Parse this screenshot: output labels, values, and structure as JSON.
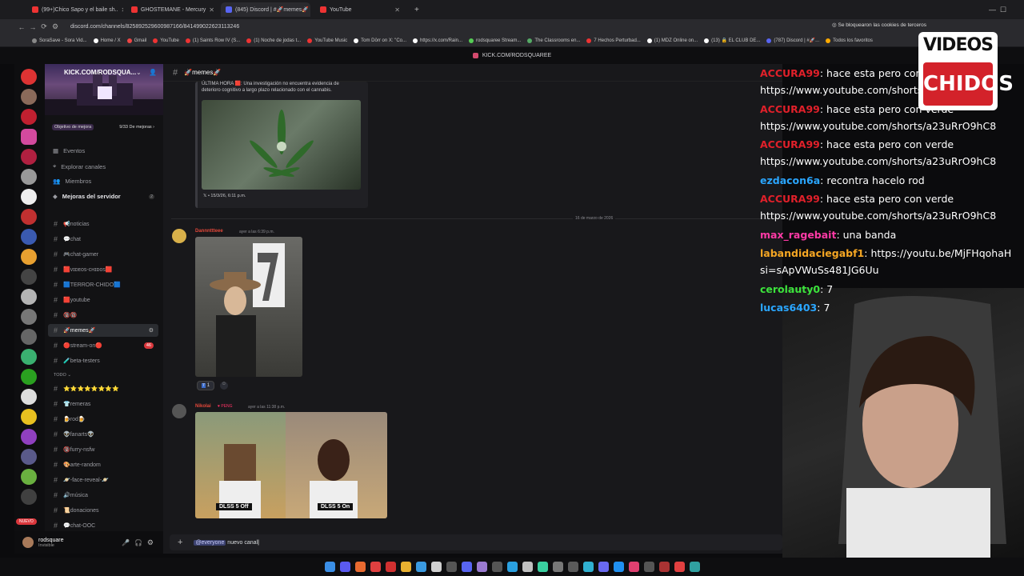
{
  "browser": {
    "tabs": [
      {
        "label": "(99+)Chico Sapo y el baile sh..",
        "color": "#e33"
      },
      {
        "label": "GHOSTEMANE - Mercury",
        "color": "#e33"
      },
      {
        "label": "(845) Discord | #🚀memes🚀",
        "color": "#5865f2"
      },
      {
        "label": "YouTube",
        "color": "#e33"
      }
    ],
    "url": "discord.com/channels/825892529600987166/841499022623113246",
    "cookie_notice": "Se bloquearon las cookies de terceros",
    "bookmarks": [
      "SoraSave - Sora Vid...",
      "Home / X",
      "Gmail",
      "YouTube",
      "(1) Saints Row IV (S...",
      "(1) Noche de jodas t...",
      "YouTube Music",
      "Tom Dōrr on X: \"Co...",
      "https://x.com/Rain...",
      "rodsquaree Stream...",
      "The Classrooms en...",
      "7 Hechos Perturbad...",
      "(1) MDZ Online on...",
      "(13) 🔒 EL CLUB DE...",
      "(787) Discord | #🚀...",
      "Todos los favoritos"
    ]
  },
  "discord": {
    "title_strip": "KICK.COM/RODSQUAREE",
    "server_name": "KICK.COM/RODSQUA...",
    "boost": {
      "left": "Objetivo de mejora",
      "right": "9/33 De mejoras ›"
    },
    "sections": [
      {
        "label": "Eventos"
      },
      {
        "label": "Explorar canales"
      },
      {
        "label": "Miembros"
      },
      {
        "label": "Mejoras del servidor",
        "badge": "2"
      }
    ],
    "channels": [
      {
        "label": "📢noticias"
      },
      {
        "label": "💬chat"
      },
      {
        "label": "🎮chat-gamer"
      },
      {
        "label": "🟥ᴠɪᴅᴇᴏs-ᴄʜɪᴅᴏs🟥"
      },
      {
        "label": "🟦TERROR-CHIDO🟦"
      },
      {
        "label": "🟥youtube"
      },
      {
        "label": "🔞🔞"
      },
      {
        "label": "🚀memes🚀",
        "selected": true
      },
      {
        "label": "🔴stream-on🔴",
        "badge": "46"
      },
      {
        "label": "🧪beta-testers"
      },
      {
        "label": "TODO ⌄",
        "category": true
      },
      {
        "label": "⭐⭐⭐⭐⭐⭐⭐⭐"
      },
      {
        "label": "👕remeras"
      },
      {
        "label": "🍺rod🍺"
      },
      {
        "label": "👽fanarts👽"
      },
      {
        "label": "🔞furry-nsfw"
      },
      {
        "label": "🎨arte-random"
      },
      {
        "label": "🪐-face-reveal-🪐"
      },
      {
        "label": "🔊música"
      },
      {
        "label": "📜donaciones"
      },
      {
        "label": "💬chat-OOC"
      }
    ],
    "new_badge": "NUEVO",
    "user": {
      "name": "rodsquare",
      "status": "Invisible"
    },
    "channel_header": "🚀memes🚀",
    "embed_text_1": "ÚLTIMA HORA 🟥: Una investigación no encuentra evidencia de",
    "embed_text_2": "deterioro cognitivo a largo plazo relacionado con el cannabis.",
    "embed_footer": "𝕏 • 15/3/26, 6:11 p.m.",
    "date_separator": "16 de marzo de 2026",
    "msg1": {
      "author": "Dannnttteee",
      "time": "ayer a las 6:39 p.m.",
      "reaction": "1"
    },
    "msg2": {
      "author": "Nikolai",
      "tag": "PENG",
      "time": "ayer a las 11:38 p.m.",
      "label_left": "DLSS 5 Off",
      "label_right": "DLSS 5 On"
    },
    "composer": {
      "mention": "@everyone",
      "text": "nuevo canal"
    }
  },
  "overlay_chat": [
    {
      "user": "ACCURA99",
      "color": "#e0202a",
      "text": ": hace esta pero con verde"
    },
    {
      "user": "",
      "color": "#fff",
      "text": "https://www.youtube.com/shorts/a23uRrO9hC8"
    },
    {
      "user": "ACCURA99",
      "color": "#e0202a",
      "text": ": hace esta pero con verde"
    },
    {
      "user": "",
      "color": "#fff",
      "text": "https://www.youtube.com/shorts/a23uRrO9hC8"
    },
    {
      "user": "ACCURA99",
      "color": "#e0202a",
      "text": ": hace esta pero con verde"
    },
    {
      "user": "",
      "color": "#fff",
      "text": "https://www.youtube.com/shorts/a23uRrO9hC8"
    },
    {
      "user": "ezdacon6a",
      "color": "#2aa6ff",
      "text": ": recontra hacelo rod"
    },
    {
      "user": "ACCURA99",
      "color": "#e0202a",
      "text": ": hace esta pero con verde"
    },
    {
      "user": "",
      "color": "#fff",
      "text": "https://www.youtube.com/shorts/a23uRrO9hC8"
    },
    {
      "user": "max_ragebait",
      "color": "#ff3aa6",
      "text": ": una banda"
    },
    {
      "user": "labandidaciegabf1",
      "color": "#f5a623",
      "text": ": https://youtu.be/MjFHqohaH"
    },
    {
      "user": "",
      "color": "#fff",
      "text": "si=sApVWuSs481JG6Uu"
    },
    {
      "user": "cerolauty0",
      "color": "#3ce33c",
      "text": ": 7"
    },
    {
      "user": "lucas6403",
      "color": "#2aa6ff",
      "text": ": 7"
    }
  ],
  "logo": {
    "line1": "VIDEOS",
    "line2": "CHIDOS"
  }
}
